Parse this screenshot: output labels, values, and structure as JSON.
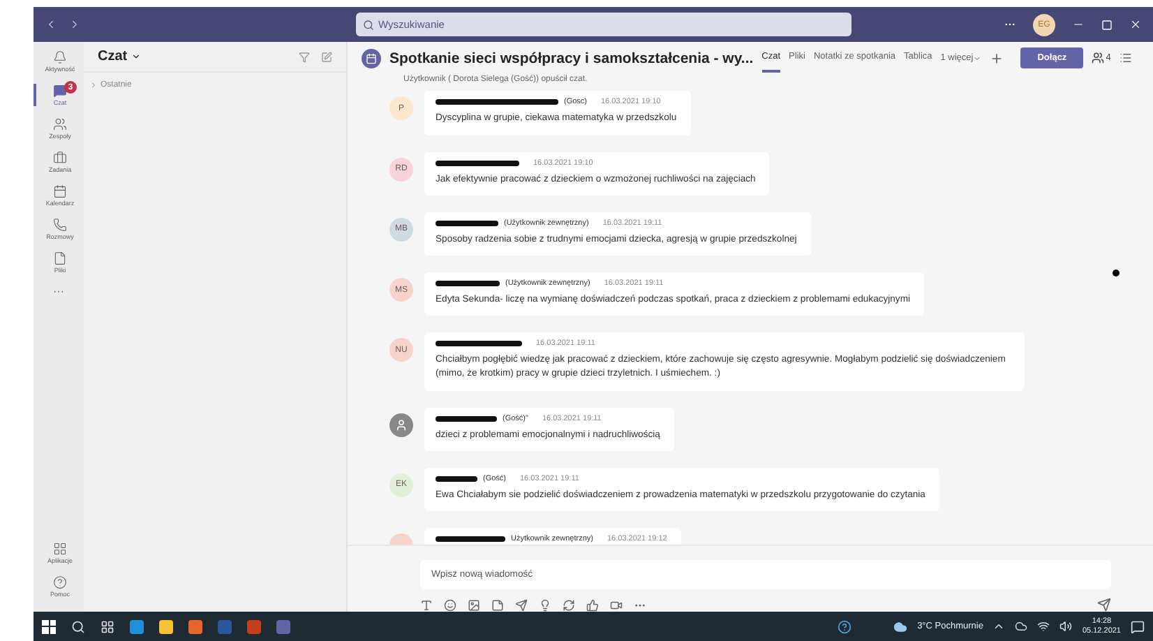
{
  "search": {
    "placeholder": "Wyszukiwanie"
  },
  "account": {
    "initials": "EG"
  },
  "rail": {
    "items": [
      {
        "label": "Aktywność",
        "selected": false
      },
      {
        "label": "Czat",
        "selected": true,
        "badge": "3"
      },
      {
        "label": "Zespoły",
        "selected": false
      },
      {
        "label": "Zadania",
        "selected": false
      },
      {
        "label": "Kalendarz",
        "selected": false
      },
      {
        "label": "Rozmowy",
        "selected": false
      },
      {
        "label": "Pliki",
        "selected": false
      }
    ],
    "more": "···",
    "bottom": [
      {
        "label": "Aplikacje"
      },
      {
        "label": "Pomoc"
      }
    ]
  },
  "chat_list": {
    "title": "Czat",
    "groups": [
      {
        "label": "Ostatnie",
        "expanded": false
      }
    ]
  },
  "meeting": {
    "title": "Spotkanie sieci współpracy i samokształcenia - wy...",
    "tabs": [
      {
        "label": "Czat",
        "selected": true
      },
      {
        "label": "Pliki",
        "selected": false
      },
      {
        "label": "Notatki ze spotkania",
        "selected": false
      },
      {
        "label": "Tablica",
        "selected": false
      }
    ],
    "more": "1 więcej",
    "join": "Dołącz",
    "participants": "4"
  },
  "system_notice": "Użytkownik ( Dorota Sielega (Gość)) opuścił czat.",
  "messages": [
    {
      "kind": "initials",
      "initials": "P",
      "color": "#fde7cf",
      "author_note": "(Gosc)",
      "time": "16.03.2021 19:10",
      "text": "Dyscyplina w grupie, ciekawa matematyka w przedszkolu"
    },
    {
      "kind": "initials",
      "initials": "RD",
      "color": "#f6d3d8",
      "time": "16.03.2021 19:10",
      "text": "Jak efektywnie pracować z dzieckiem o wzmożonej ruchliwości na zajęciach"
    },
    {
      "kind": "initials",
      "initials": "MB",
      "color": "#cfdbe2",
      "author_note": "(Użytkownik zewnętrzny)",
      "time": "16.03.2021 19:11",
      "text": "Sposoby radzenia sobie z trudnymi emocjami dziecka, agresją w grupie przedszkolnej"
    },
    {
      "kind": "initials",
      "initials": "MS",
      "color": "#f7d4cb",
      "author_note": "(Użytkownik zewnętrzny)",
      "time": "16.03.2021 19:11",
      "text": "Edyta Sekunda- liczę na wymianę doświadczeń podczas spotkań, praca z dzieckiem z problemami edukacyjnymi"
    },
    {
      "kind": "initials",
      "initials": "NU",
      "color": "#f7d4cb",
      "time": "16.03.2021 19:11",
      "text": "Chciałbym pogłębić wiedzę jak pracować z dzieckiem, które zachowuje się często agresywnie. Mogłabym podzielić się doświadczeniem (mimo, że krotkim) pracy w grupie dzieci trzyletnich. I uśmiechem. :)"
    },
    {
      "kind": "person",
      "color": "#8a8886",
      "author_note": "(Gość)\"",
      "time": "16.03.2021 19:11",
      "text": "dzieci z problemami emocjonalnymi i nadruchliwością"
    },
    {
      "kind": "initials",
      "initials": "EK",
      "color": "#e3f0d9",
      "author_note": "(Gość)",
      "time": "16.03.2021 19:11",
      "text": "Ewa  Chciałabym sie podzielić doświadczeniem z prowadzenia matematyki w przedszkolu  przygotowanie do czytania"
    },
    {
      "kind": "partial",
      "color": "#f7d4cb",
      "author_note": "Użytkownik zewnętrzny)",
      "time": "16.03.2021 19:12"
    }
  ],
  "compose": {
    "placeholder": "Wpisz nową wiadomość"
  },
  "taskbar": {
    "weather": "3°C Pochmurnie",
    "time": "14:28",
    "date": "05.12.2021"
  }
}
